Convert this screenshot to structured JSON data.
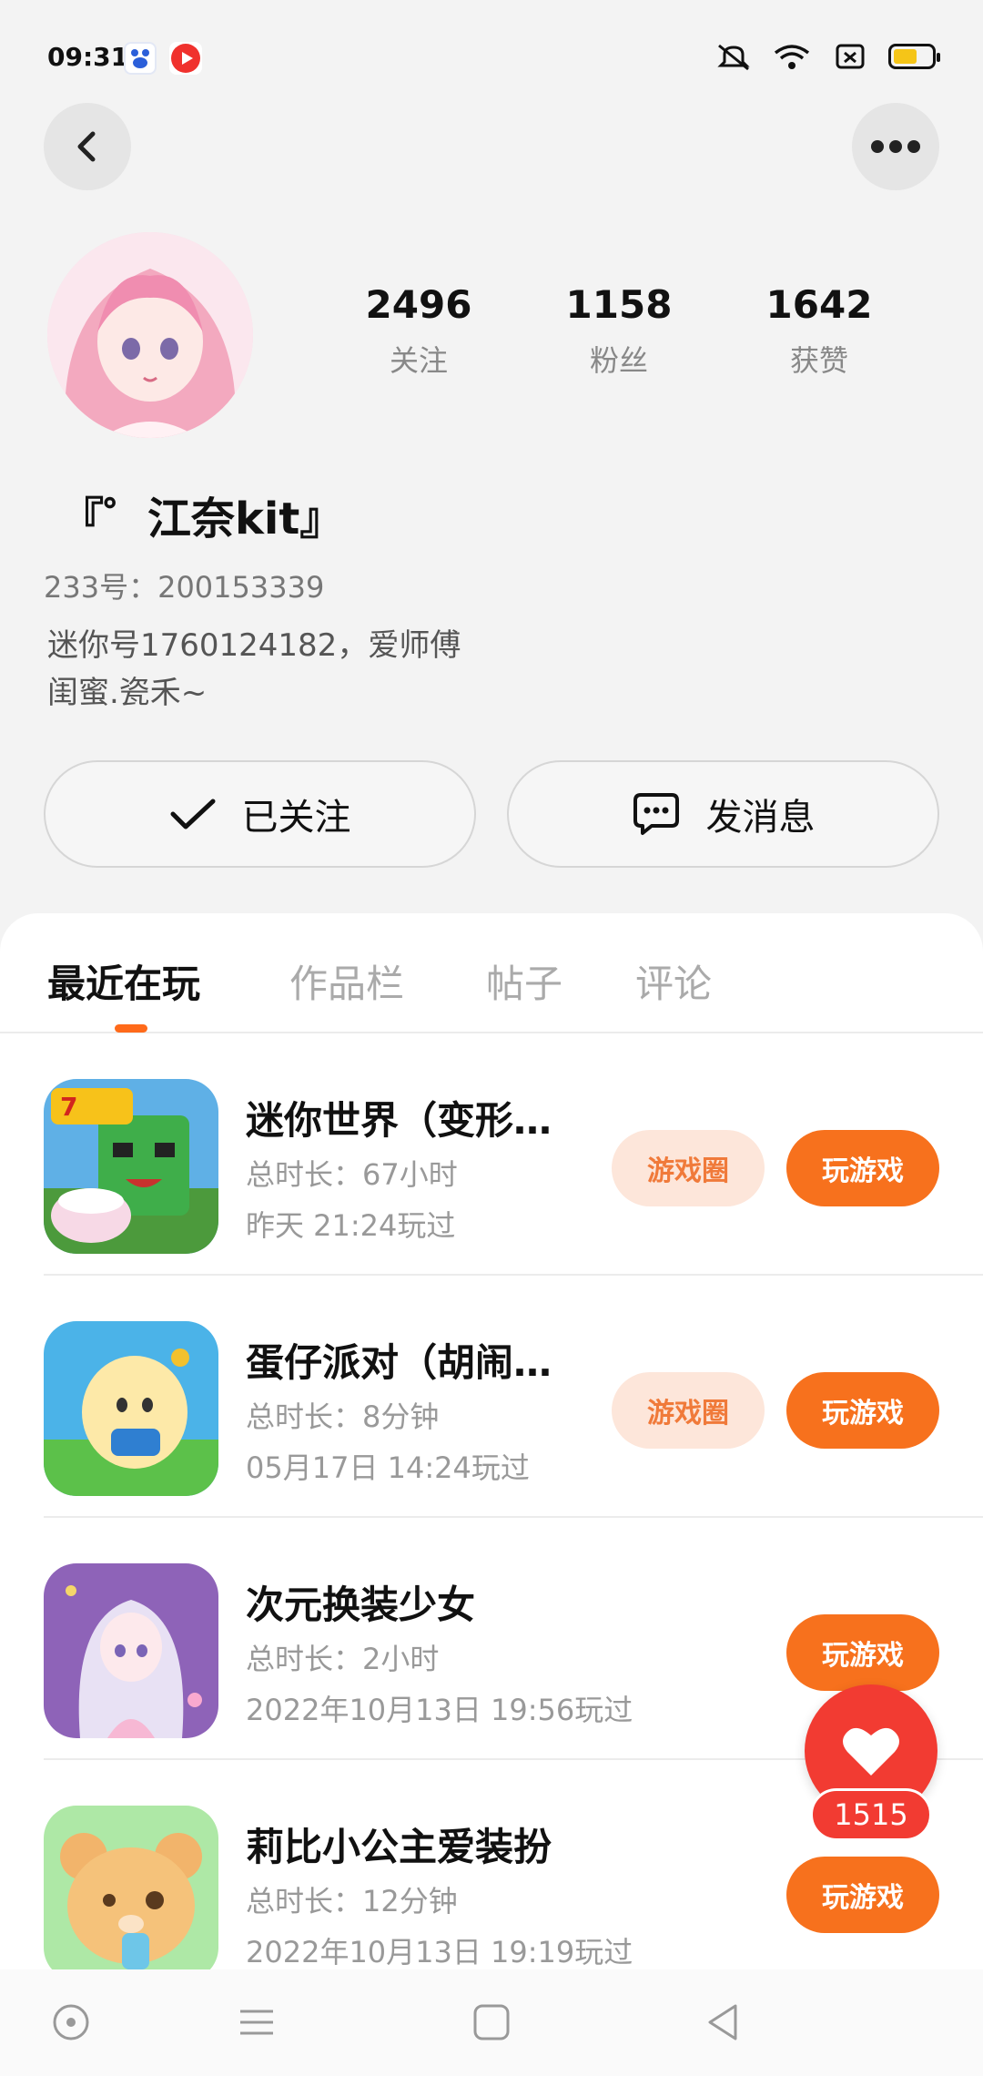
{
  "status_bar": {
    "time": "09:31",
    "battery_level": 0.55,
    "battery_color": "#f5c518"
  },
  "nav": {
    "back_icon": "chevron-left-icon",
    "more_icon": "more-dots-icon"
  },
  "profile": {
    "username": "『゜江奈kit』",
    "uid": "233号：200153339",
    "bio_line1": "迷你号1760124182，爱师傅",
    "bio_line2": "闺蜜.瓷禾~",
    "stats": [
      {
        "value": "2496",
        "label": "关注"
      },
      {
        "value": "1158",
        "label": "粉丝"
      },
      {
        "value": "1642",
        "label": "获赞"
      }
    ]
  },
  "actions": {
    "follow_label": "已关注",
    "message_label": "发消息"
  },
  "tabs": [
    {
      "label": "最近在玩",
      "active": true
    },
    {
      "label": "作品栏",
      "active": false
    },
    {
      "label": "帖子",
      "active": false
    },
    {
      "label": "评论",
      "active": false
    }
  ],
  "games": [
    {
      "title": "迷你世界（变形…",
      "duration": "总时长：67小时",
      "last_played": "昨天  21:24玩过",
      "circle_label": "游戏圈",
      "play_label": "玩游戏"
    },
    {
      "title": "蛋仔派对（胡闹…",
      "duration": "总时长：8分钟",
      "last_played": "05月17日  14:24玩过",
      "circle_label": "游戏圈",
      "play_label": "玩游戏"
    },
    {
      "title": "次元换装少女",
      "duration": "总时长：2小时",
      "last_played": "2022年10月13日  19:56玩过",
      "circle_label": "",
      "play_label": "玩游戏"
    },
    {
      "title": "莉比小公主爱装扮",
      "duration": "总时长：12分钟",
      "last_played": "2022年10月13日  19:19玩过",
      "circle_label": "",
      "play_label": "玩游戏"
    }
  ],
  "floating_like": {
    "count": "1515",
    "color": "#f23b32"
  },
  "accent_color": "#f7711d"
}
